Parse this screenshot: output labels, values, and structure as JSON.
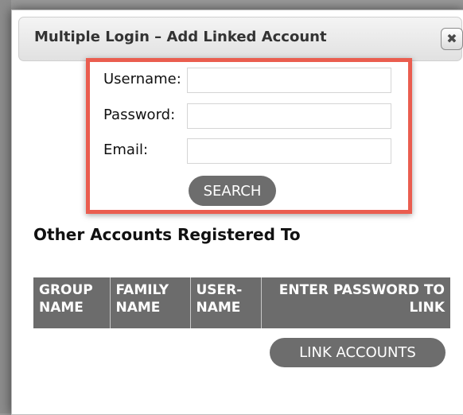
{
  "dialog": {
    "title": "Multiple Login – Add Linked Account",
    "close_symbol": "✖"
  },
  "search_form": {
    "username_label": "Username:",
    "username_value": "",
    "password_label": "Password:",
    "password_value": "",
    "email_label": "Email:",
    "email_value": "",
    "search_button_label": "SEARCH",
    "highlight_color": "#ea5d4f"
  },
  "accounts": {
    "heading": "Other Accounts Registered To",
    "columns": [
      "GROUP NAME",
      "FAMILY NAME",
      "USER-NAME",
      "ENTER PASSWORD TO LINK"
    ],
    "rows": [],
    "link_button_label": "LINK ACCOUNTS"
  },
  "icons": {
    "close": "close-icon"
  }
}
